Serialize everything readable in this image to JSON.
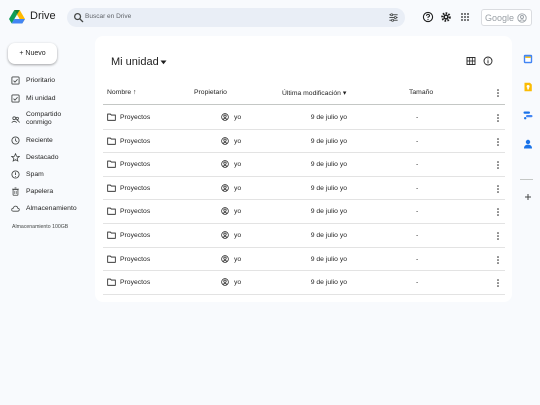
{
  "header": {
    "app_name": "Drive",
    "search_placeholder": "Buscar en Drive",
    "account_label": "Google"
  },
  "sidebar": {
    "new_label": "+ Nuevo",
    "items": [
      {
        "label": "Prioritario",
        "icon": "checkbox-icon"
      },
      {
        "label": "Mi unidad",
        "icon": "checkbox-icon"
      },
      {
        "label": "Compartido conmigo",
        "icon": "people-icon"
      },
      {
        "label": "Reciente",
        "icon": "clock-icon"
      },
      {
        "label": "Destacado",
        "icon": "star-icon"
      },
      {
        "label": "Spam",
        "icon": "spam-icon"
      },
      {
        "label": "Papelera",
        "icon": "trash-icon"
      },
      {
        "label": "Almacenamiento",
        "icon": "cloud-icon"
      }
    ],
    "storage_text": "Almacenamiento 100GB"
  },
  "main": {
    "title": "Mi unidad",
    "columns": {
      "name": "Nombre ↑",
      "owner": "Propietario",
      "modified": "Última modificación ▾",
      "size": "Tamaño"
    },
    "rows": [
      {
        "name": "Proyectos",
        "owner": "yo",
        "modified": "9 de julio yo",
        "size": "-"
      },
      {
        "name": "Proyectos",
        "owner": "yo",
        "modified": "9 de julio yo",
        "size": "-"
      },
      {
        "name": "Proyectos",
        "owner": "yo",
        "modified": "9 de julio yo",
        "size": "-"
      },
      {
        "name": "Proyectos",
        "owner": "yo",
        "modified": "9 de julio yo",
        "size": "-"
      },
      {
        "name": "Proyectos",
        "owner": "yo",
        "modified": "9 de julio yo",
        "size": "-"
      },
      {
        "name": "Proyectos",
        "owner": "yo",
        "modified": "9 de julio yo",
        "size": "-"
      },
      {
        "name": "Proyectos",
        "owner": "yo",
        "modified": "9 de julio yo",
        "size": "-"
      },
      {
        "name": "Proyectos",
        "owner": "yo",
        "modified": "9 de julio yo",
        "size": "-"
      }
    ]
  },
  "right_rail": {
    "items": [
      "calendar-icon",
      "keep-icon",
      "tasks-icon",
      "contacts-icon",
      "add-icon"
    ]
  },
  "colors": {
    "page_bg": "#f8fafd",
    "search_bg": "#e9eef6",
    "panel_bg": "#ffffff",
    "text": "#1f1f1f"
  }
}
